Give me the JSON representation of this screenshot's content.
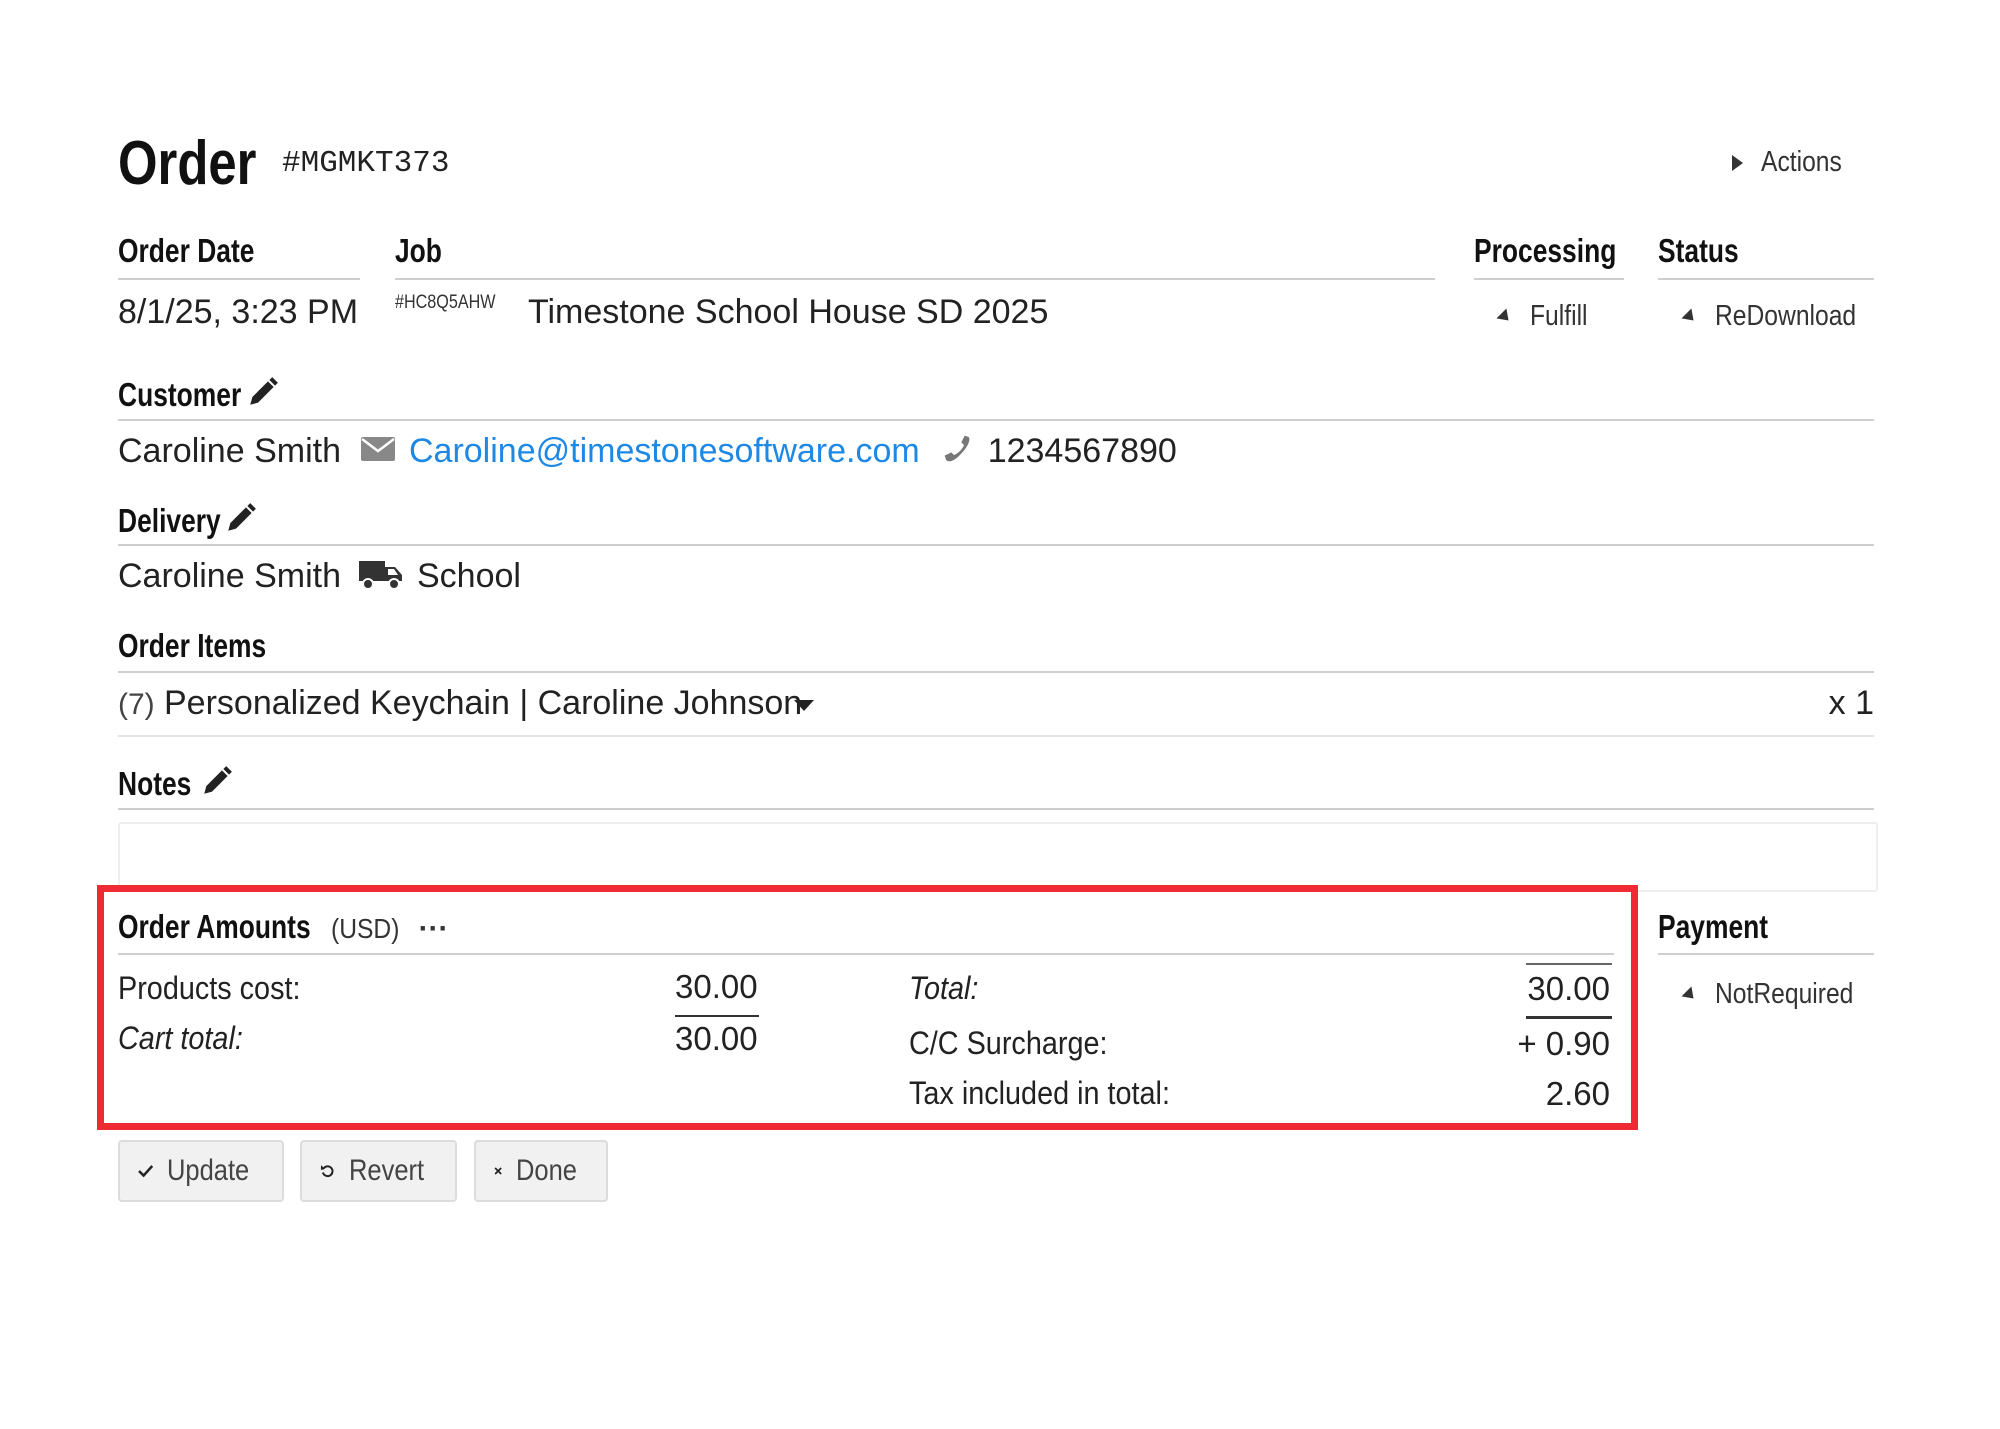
{
  "header": {
    "title": "Order",
    "order_code": "#MGMKT373",
    "actions_label": "Actions"
  },
  "columns": {
    "order_date_label": "Order Date",
    "job_label": "Job",
    "processing_label": "Processing",
    "status_label": "Status"
  },
  "order": {
    "date": "8/1/25, 3:23 PM",
    "job_code": "#HC8Q5AHW",
    "job_name": "Timestone School House SD 2025",
    "processing": "Fulfill",
    "status": "ReDownload"
  },
  "customer": {
    "label": "Customer",
    "name": "Caroline Smith",
    "email": "Caroline@timestonesoftware.com",
    "phone": "1234567890"
  },
  "delivery": {
    "label": "Delivery",
    "name": "Caroline Smith",
    "method": "School"
  },
  "items": {
    "label": "Order Items",
    "list": [
      {
        "id": "(7)",
        "name": "Personalized Keychain | Caroline Johnson",
        "qty": "x 1"
      }
    ]
  },
  "notes": {
    "label": "Notes",
    "value": ""
  },
  "amounts": {
    "label": "Order Amounts",
    "currency": "(USD)",
    "more": "···",
    "products_cost_label": "Products cost:",
    "products_cost": "30.00",
    "cart_total_label": "Cart total:",
    "cart_total": "30.00",
    "total_label": "Total:",
    "total": "30.00",
    "surcharge_label": "C/C Surcharge:",
    "surcharge": "+ 0.90",
    "tax_label": "Tax included in total:",
    "tax": "2.60"
  },
  "payment": {
    "label": "Payment",
    "value": "NotRequired"
  },
  "buttons": {
    "update": "Update",
    "revert": "Revert",
    "done": "Done"
  },
  "colors": {
    "accent_link": "#1e88e5",
    "highlight": "#ee2b34"
  }
}
